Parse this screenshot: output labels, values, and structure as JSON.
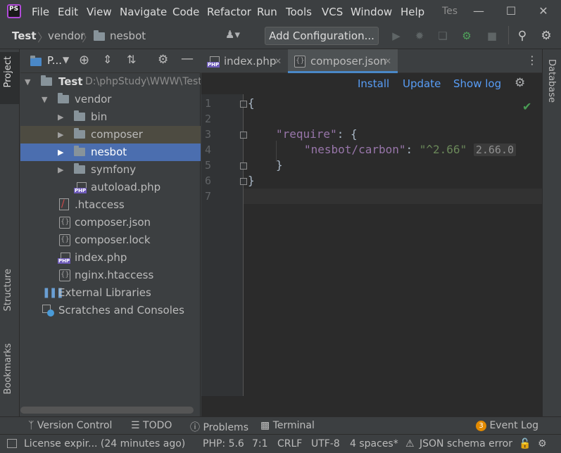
{
  "menu": {
    "items": [
      "File",
      "Edit",
      "View",
      "Navigate",
      "Code",
      "Refactor",
      "Run",
      "Tools",
      "VCS",
      "Window",
      "Help"
    ],
    "window_title": "Tes"
  },
  "navbar": {
    "breadcrumbs": [
      "Test",
      "vendor",
      "nesbot"
    ],
    "add_configuration": "Add Configuration..."
  },
  "project_panel": {
    "title": "P...",
    "root_name": "Test",
    "root_path": "D:\\phpStudy\\WWW\\Test",
    "tree": [
      {
        "name": "vendor",
        "type": "folder",
        "expanded": true
      },
      {
        "name": "bin",
        "type": "folder"
      },
      {
        "name": "composer",
        "type": "folder"
      },
      {
        "name": "nesbot",
        "type": "folder",
        "selected": true
      },
      {
        "name": "symfony",
        "type": "folder"
      },
      {
        "name": "autoload.php",
        "type": "php"
      },
      {
        "name": ".htaccess",
        "type": "htaccess"
      },
      {
        "name": "composer.json",
        "type": "json"
      },
      {
        "name": "composer.lock",
        "type": "json"
      },
      {
        "name": "index.php",
        "type": "php"
      },
      {
        "name": "nginx.htaccess",
        "type": "json"
      },
      {
        "name": "External Libraries",
        "type": "library"
      },
      {
        "name": "Scratches and Consoles",
        "type": "scratch"
      }
    ]
  },
  "side_tabs": {
    "left": [
      "Project",
      "Structure",
      "Bookmarks"
    ],
    "right": [
      "Database"
    ]
  },
  "editor_tabs": [
    {
      "label": "index.php",
      "active": false
    },
    {
      "label": "composer.json",
      "active": true
    }
  ],
  "composer_toolbar": {
    "install": "Install",
    "update": "Update",
    "show_log": "Show log"
  },
  "editor": {
    "line_numbers": [
      "1",
      "2",
      "3",
      "4",
      "5",
      "6",
      "7"
    ],
    "lines": {
      "l1": "{",
      "l3_key": "\"require\"",
      "l3_rest": ": {",
      "l4_key": "\"nesbot/carbon\"",
      "l4_colon": ": ",
      "l4_value": "\"^2.66\"",
      "l4_hint": "2.66.0",
      "l5": "}",
      "l6": "}"
    }
  },
  "toolwindows": {
    "version_control": "Version Control",
    "todo": "TODO",
    "problems": "Problems",
    "terminal": "Terminal",
    "event_log": "Event Log",
    "event_count": "3"
  },
  "status": {
    "license": "License expir... (24 minutes ago)",
    "php": "PHP: 5.6",
    "position": "7:1",
    "line_sep": "CRLF",
    "encoding": "UTF-8",
    "indent": "4 spaces*",
    "schema": "JSON schema error"
  },
  "colors": {
    "accent": "#4a88c7",
    "selection": "#4b6eaf",
    "link": "#589df6",
    "success": "#499c54"
  }
}
